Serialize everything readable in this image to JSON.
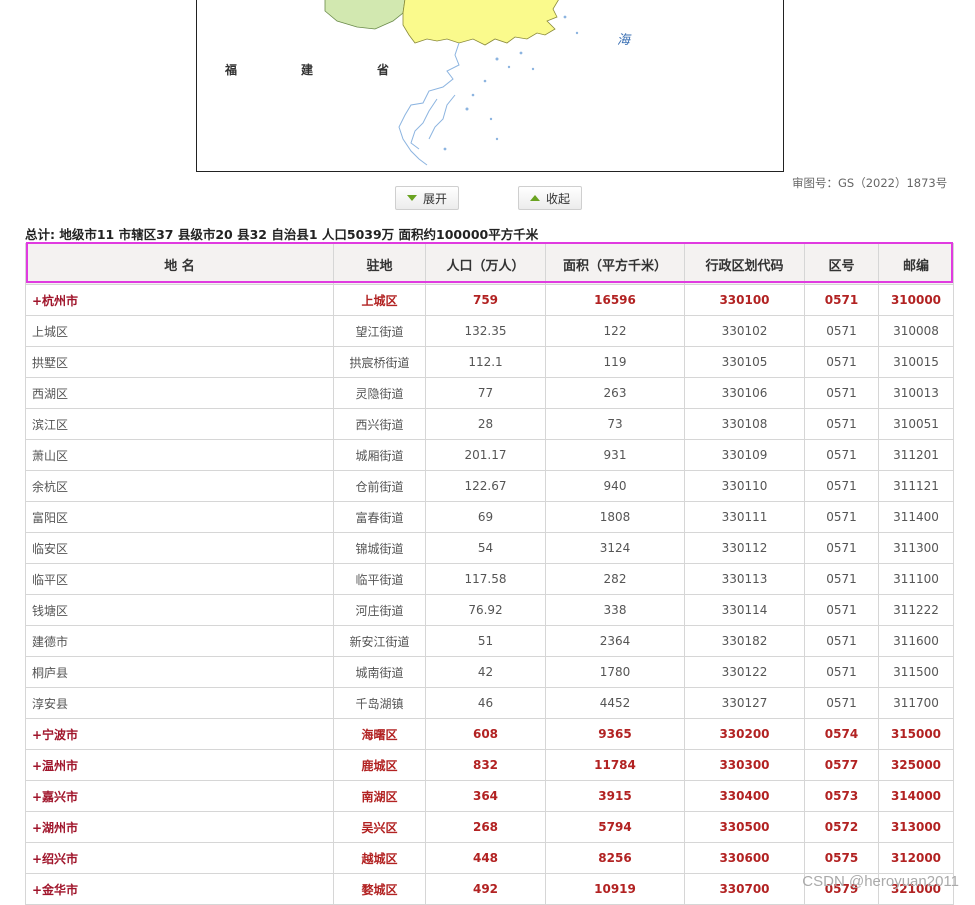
{
  "map": {
    "labels": {
      "fu": "福",
      "jian": "建",
      "sheng": "省",
      "sea": "海"
    },
    "approval_number": "审图号：GS（2022）1873号"
  },
  "controls": {
    "expand_label": "展开",
    "collapse_label": "收起"
  },
  "summary": "总计: 地级市11 市辖区37 县级市20 县32 自治县1 人口5039万 面积约100000平方千米",
  "table": {
    "headers": [
      "地 名",
      "驻地",
      "人口（万人）",
      "面积（平方千米）",
      "行政区划代码",
      "区号",
      "邮编"
    ],
    "rows": [
      {
        "name": "+杭州市",
        "seat": "上城区",
        "pop": "759",
        "area": "16596",
        "code": "330100",
        "phone": "0571",
        "post": "310000",
        "city": true
      },
      {
        "name": "上城区",
        "seat": "望江街道",
        "pop": "132.35",
        "area": "122",
        "code": "330102",
        "phone": "0571",
        "post": "310008",
        "city": false
      },
      {
        "name": "拱墅区",
        "seat": "拱宸桥街道",
        "pop": "112.1",
        "area": "119",
        "code": "330105",
        "phone": "0571",
        "post": "310015",
        "city": false
      },
      {
        "name": "西湖区",
        "seat": "灵隐街道",
        "pop": "77",
        "area": "263",
        "code": "330106",
        "phone": "0571",
        "post": "310013",
        "city": false
      },
      {
        "name": "滨江区",
        "seat": "西兴街道",
        "pop": "28",
        "area": "73",
        "code": "330108",
        "phone": "0571",
        "post": "310051",
        "city": false
      },
      {
        "name": "萧山区",
        "seat": "城厢街道",
        "pop": "201.17",
        "area": "931",
        "code": "330109",
        "phone": "0571",
        "post": "311201",
        "city": false
      },
      {
        "name": "余杭区",
        "seat": "仓前街道",
        "pop": "122.67",
        "area": "940",
        "code": "330110",
        "phone": "0571",
        "post": "311121",
        "city": false
      },
      {
        "name": "富阳区",
        "seat": "富春街道",
        "pop": "69",
        "area": "1808",
        "code": "330111",
        "phone": "0571",
        "post": "311400",
        "city": false
      },
      {
        "name": "临安区",
        "seat": "锦城街道",
        "pop": "54",
        "area": "3124",
        "code": "330112",
        "phone": "0571",
        "post": "311300",
        "city": false
      },
      {
        "name": "临平区",
        "seat": "临平街道",
        "pop": "117.58",
        "area": "282",
        "code": "330113",
        "phone": "0571",
        "post": "311100",
        "city": false
      },
      {
        "name": "钱塘区",
        "seat": "河庄街道",
        "pop": "76.92",
        "area": "338",
        "code": "330114",
        "phone": "0571",
        "post": "311222",
        "city": false
      },
      {
        "name": "建德市",
        "seat": "新安江街道",
        "pop": "51",
        "area": "2364",
        "code": "330182",
        "phone": "0571",
        "post": "311600",
        "city": false
      },
      {
        "name": "桐庐县",
        "seat": "城南街道",
        "pop": "42",
        "area": "1780",
        "code": "330122",
        "phone": "0571",
        "post": "311500",
        "city": false
      },
      {
        "name": "淳安县",
        "seat": "千岛湖镇",
        "pop": "46",
        "area": "4452",
        "code": "330127",
        "phone": "0571",
        "post": "311700",
        "city": false
      },
      {
        "name": "+宁波市",
        "seat": "海曙区",
        "pop": "608",
        "area": "9365",
        "code": "330200",
        "phone": "0574",
        "post": "315000",
        "city": true
      },
      {
        "name": "+温州市",
        "seat": "鹿城区",
        "pop": "832",
        "area": "11784",
        "code": "330300",
        "phone": "0577",
        "post": "325000",
        "city": true
      },
      {
        "name": "+嘉兴市",
        "seat": "南湖区",
        "pop": "364",
        "area": "3915",
        "code": "330400",
        "phone": "0573",
        "post": "314000",
        "city": true
      },
      {
        "name": "+湖州市",
        "seat": "吴兴区",
        "pop": "268",
        "area": "5794",
        "code": "330500",
        "phone": "0572",
        "post": "313000",
        "city": true
      },
      {
        "name": "+绍兴市",
        "seat": "越城区",
        "pop": "448",
        "area": "8256",
        "code": "330600",
        "phone": "0575",
        "post": "312000",
        "city": true
      },
      {
        "name": "+金华市",
        "seat": "婺城区",
        "pop": "492",
        "area": "10919",
        "code": "330700",
        "phone": "0579",
        "post": "321000",
        "city": true
      }
    ]
  },
  "watermark": "CSDN @heroyuan2011",
  "colors": {
    "city_text": "#b22222",
    "highlight": "#e03be0",
    "map_fill_yellow": "#fafa8c",
    "map_fill_green": "#d2e8b0"
  }
}
